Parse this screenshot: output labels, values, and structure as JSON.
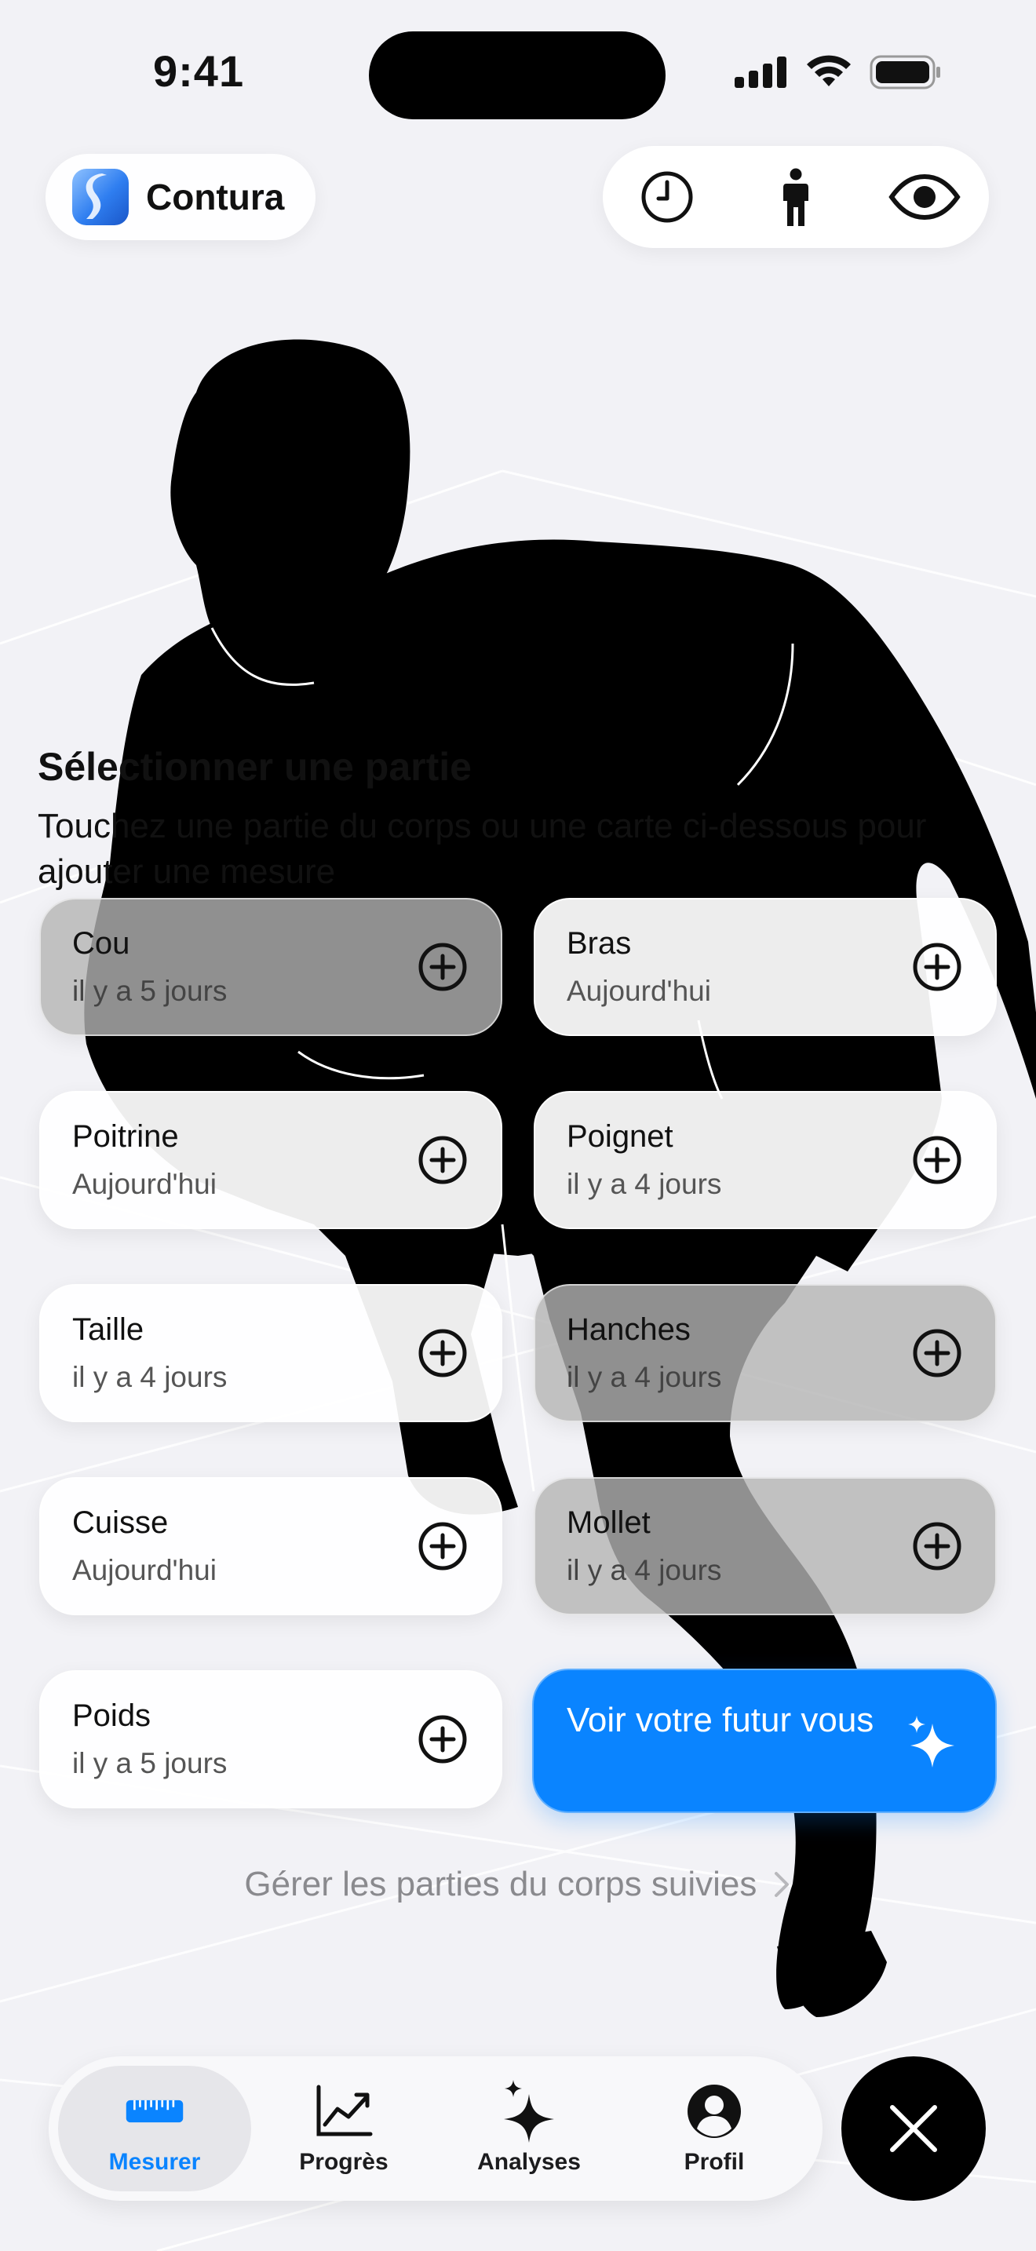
{
  "status_bar": {
    "time": "9:41"
  },
  "brand": {
    "name": "Contura"
  },
  "toolbar": {
    "history_icon": "clock-icon",
    "body_icon": "person-icon",
    "visibility_icon": "eye-icon"
  },
  "section": {
    "title": "Sélectionner une partie",
    "subtitle": "Touchez une partie du corps ou une carte ci-dessous pour ajouter une mesure"
  },
  "cards": [
    {
      "label": "Cou",
      "time": "il y a 5 jours"
    },
    {
      "label": "Bras",
      "time": "Aujourd'hui"
    },
    {
      "label": "Poitrine",
      "time": "Aujourd'hui"
    },
    {
      "label": "Poignet",
      "time": "il y a 4 jours"
    },
    {
      "label": "Taille",
      "time": "il y a 4 jours"
    },
    {
      "label": "Hanches",
      "time": "il y a 4 jours"
    },
    {
      "label": "Cuisse",
      "time": "Aujourd'hui"
    },
    {
      "label": "Mollet",
      "time": "il y a 4 jours"
    },
    {
      "label": "Poids",
      "time": "il y a 5 jours"
    }
  ],
  "cta": {
    "label": "Voir votre futur vous",
    "icon": "sparkles-icon"
  },
  "manage_link": {
    "label": "Gérer les parties du corps suivies"
  },
  "tabbar": {
    "tabs": [
      {
        "label": "Mesurer",
        "icon": "ruler-icon"
      },
      {
        "label": "Progrès",
        "icon": "chart-line-icon"
      },
      {
        "label": "Analyses",
        "icon": "sparkles-icon"
      },
      {
        "label": "Profil",
        "icon": "profile-icon"
      }
    ]
  },
  "colors": {
    "accent": "#0a84ff",
    "background": "#f2f2f6"
  }
}
